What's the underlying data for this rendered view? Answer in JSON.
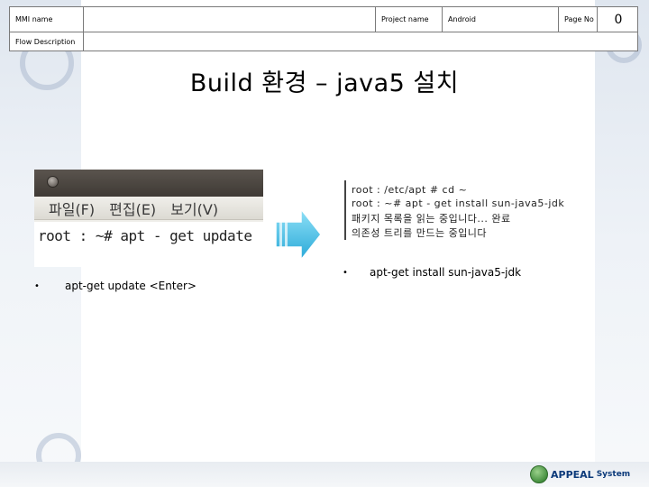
{
  "header": {
    "mmi_name_label": "MMI name",
    "mmi_name_value": "",
    "project_name_label": "Project name",
    "project_name_value": "Android",
    "page_no_label": "Page No",
    "page_no_value": "0",
    "flow_description_label": "Flow Description",
    "flow_description_value": ""
  },
  "title": "Build 환경 – java5 설치",
  "left_screenshot": {
    "menu": [
      "파일(F)",
      "편집(E)",
      "보기(V)"
    ],
    "command": "root : ~# apt - get update"
  },
  "right_screenshot": {
    "lines": [
      "root : /etc/apt # cd ~",
      "root : ~# apt - get install sun-java5-jdk",
      "패키지 목록을 읽는 중입니다... 완료",
      "의존성 트리를 만드는 중입니다"
    ]
  },
  "bullets": {
    "left": "apt-get update <Enter>",
    "right": "apt-get install sun-java5-jdk",
    "marker": "•"
  },
  "footer": {
    "logo_text": "APPEAL",
    "logo_sub": "System"
  },
  "colors": {
    "border": "#7a7a7a",
    "logo_blue": "#0b3a7a",
    "logo_green": "#3f8b3a",
    "arrow": "#4fc3e8"
  }
}
